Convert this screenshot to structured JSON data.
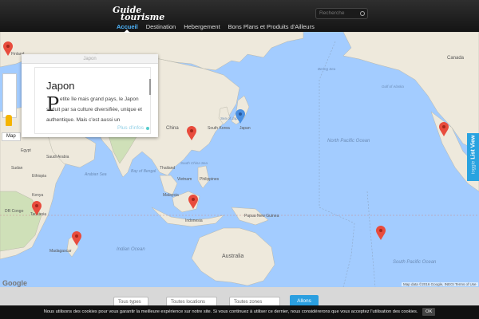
{
  "header": {
    "logo_line1": "Guide",
    "logo_line2": "tourisme",
    "nav": [
      {
        "label": "Accueil",
        "active": true
      },
      {
        "label": "Destination",
        "active": false
      },
      {
        "label": "Hebergement",
        "active": false
      },
      {
        "label": "Bons Plans et Produits d'Ailleurs",
        "active": false
      }
    ],
    "search_placeholder": "Recherche",
    "accent_color": "#4fb7ff"
  },
  "map": {
    "map_type_label": "Map",
    "google_logo": "Google",
    "attribution": "Map data ©2016 Google, INEGI",
    "terms": "Terms of Use",
    "labels": {
      "finland": "Finland",
      "china": "China",
      "south_korea": "South Korea",
      "japan": "Japan",
      "egypt": "Egypt",
      "saudi_arabia": "Saudi Arabia",
      "sudan": "Sudan",
      "ethiopia": "Ethiopia",
      "kenya": "Kenya",
      "tanzania": "Tanzania",
      "dr_congo": "DR Congo",
      "madagascar": "Madagascar",
      "thailand": "Thailand",
      "vietnam": "Vietnam",
      "philippines": "Philippines",
      "malaysia": "Malaysia",
      "indonesia": "Indonesia",
      "papua_new_guinea": "Papua New Guinea",
      "australia": "Australia",
      "canada": "Canada",
      "indian_ocean": "Indian Ocean",
      "north_pacific_ocean": "North Pacific Ocean",
      "south_pacific_ocean": "South Pacific Ocean",
      "bay_of_bengal": "Bay of Bengal",
      "arabian_sea": "Arabian Sea",
      "sea_of_japan": "Sea of Japan",
      "south_china_sea": "South China Sea",
      "bering_sea": "Bering Sea",
      "gulf_of_alaska": "Gulf of Alaska"
    },
    "pins": [
      {
        "name": "pin-finland",
        "color": "#e84c3d"
      },
      {
        "name": "pin-china",
        "color": "#e84c3d"
      },
      {
        "name": "pin-japan",
        "color": "#4a90e2"
      },
      {
        "name": "pin-tanzania",
        "color": "#e84c3d"
      },
      {
        "name": "pin-madagascar",
        "color": "#e84c3d"
      },
      {
        "name": "pin-indonesia",
        "color": "#e84c3d"
      },
      {
        "name": "pin-polynesia",
        "color": "#e84c3d"
      },
      {
        "name": "pin-mexico",
        "color": "#e84c3d"
      }
    ],
    "list_view_prefix": "Toggle",
    "list_view_label": "List View"
  },
  "popup": {
    "header": "Japon",
    "title": "Japon",
    "dropcap": "P",
    "text": "etite île mais grand pays, le Japon séduit par sa culture diversifiée, unique et authentique. Mais c'est aussi un",
    "more": "Plus d'infos"
  },
  "filters": [
    {
      "label": "Tous types"
    },
    {
      "label": "Toutes locations"
    },
    {
      "label": "Toutes zones"
    }
  ],
  "go_button": "Allons",
  "cookie": {
    "text": "Nous utilisons des cookies pour vous garantir la meilleure expérience sur notre site. Si vous continuez à utiliser ce dernier, nous considérerons que vous acceptez l'utilisation des cookies.",
    "ok": "OK"
  }
}
